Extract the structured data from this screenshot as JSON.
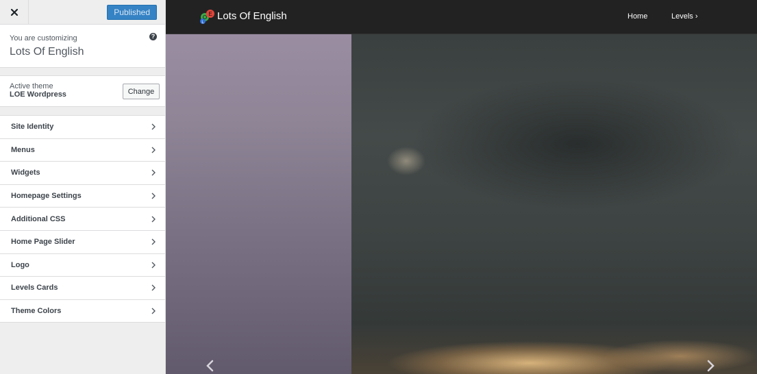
{
  "customizer": {
    "close_icon": "close-icon",
    "publish_label": "Published",
    "info": {
      "pre_title": "You are customizing",
      "site_title": "Lots Of English",
      "help_icon": "?"
    },
    "theme": {
      "label": "Active theme",
      "name": "LOE Wordpress",
      "change_label": "Change"
    },
    "panels": [
      {
        "label": "Site Identity"
      },
      {
        "label": "Menus"
      },
      {
        "label": "Widgets"
      },
      {
        "label": "Homepage Settings"
      },
      {
        "label": "Additional CSS"
      },
      {
        "label": "Home Page Slider"
      },
      {
        "label": "Logo"
      },
      {
        "label": "Levels Cards"
      },
      {
        "label": "Theme Colors"
      }
    ]
  },
  "preview": {
    "site_title": "Lots Of English",
    "logo_letters": [
      "O",
      "E",
      "L"
    ],
    "nav": {
      "home": "Home",
      "levels": "Levels ›"
    },
    "slider_arrows": [
      "chevron-left-icon",
      "chevron-right-icon"
    ]
  },
  "colors": {
    "publish_button": "#3582c4",
    "nav_bar": "#222222",
    "logo_o": "#3ea84a",
    "logo_e": "#e0453a",
    "logo_l": "#2f6fd6"
  }
}
